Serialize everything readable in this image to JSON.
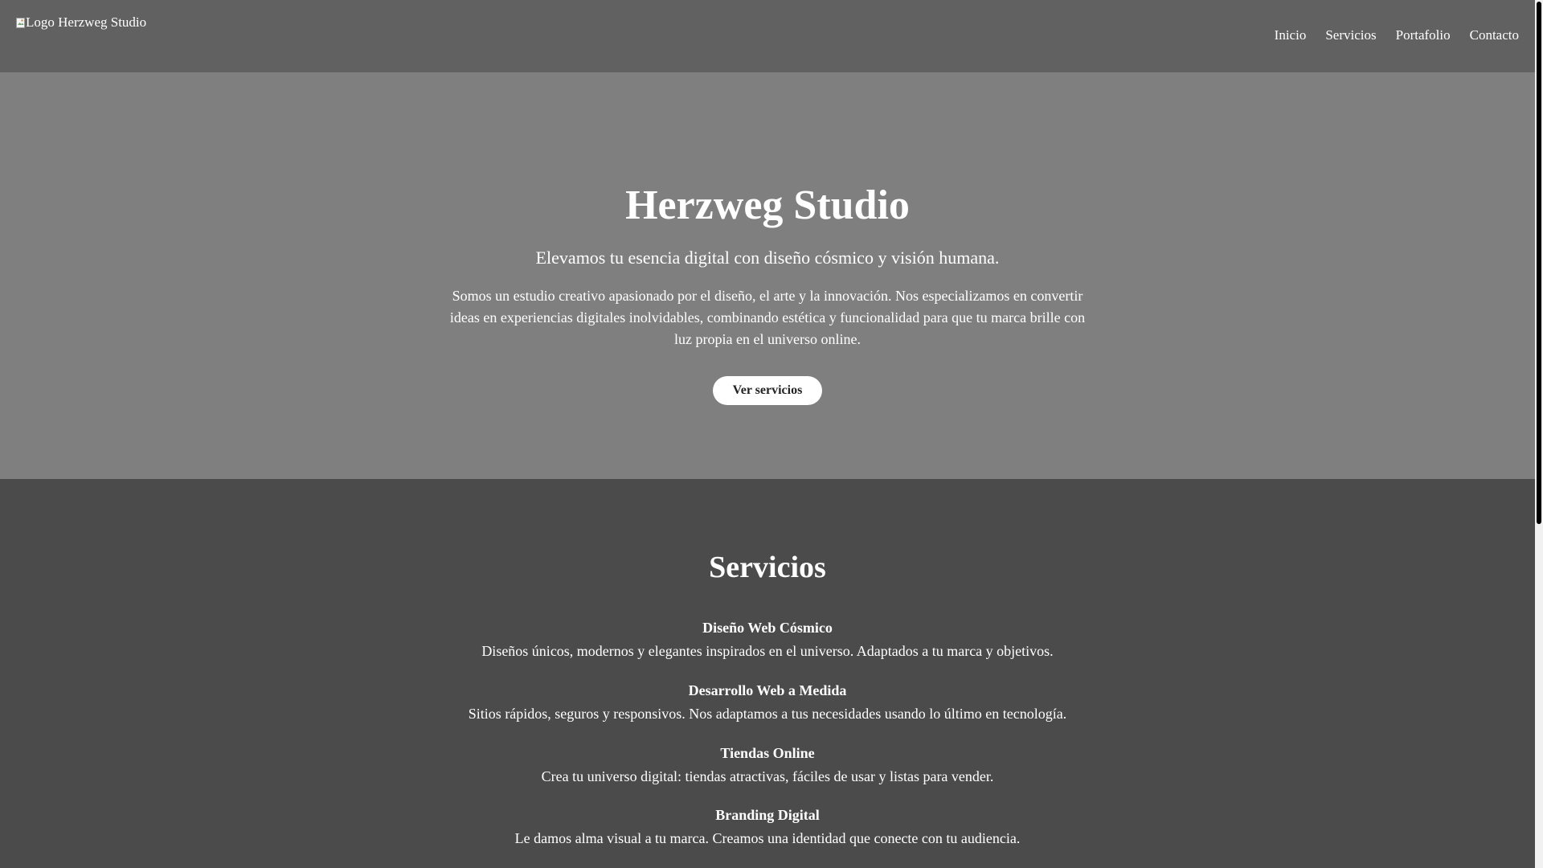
{
  "header": {
    "logo_alt": "Logo Herzweg Studio",
    "nav": [
      {
        "label": "Inicio"
      },
      {
        "label": "Servicios"
      },
      {
        "label": "Portafolio"
      },
      {
        "label": "Contacto"
      }
    ]
  },
  "hero": {
    "title": "Herzweg Studio",
    "subtitle": "Elevamos tu esencia digital con diseño cósmico y visión humana.",
    "description": "Somos un estudio creativo apasionado por el diseño, el arte y la innovación. Nos especializamos en convertir ideas en experiencias digitales inolvidables, combinando estética y funcionalidad para que tu marca brille con luz propia en el universo online.",
    "cta_label": "Ver servicios"
  },
  "services": {
    "title": "Servicios",
    "items": [
      {
        "name": "Diseño Web Cósmico",
        "desc": "Diseños únicos, modernos y elegantes inspirados en el universo. Adaptados a tu marca y objetivos."
      },
      {
        "name": "Desarrollo Web a Medida",
        "desc": "Sitios rápidos, seguros y responsivos. Nos adaptamos a tus necesidades usando lo último en tecnología."
      },
      {
        "name": "Tiendas Online",
        "desc": "Crea tu universo digital: tiendas atractivas, fáciles de usar y listas para vender."
      },
      {
        "name": "Branding Digital",
        "desc": "Le damos alma visual a tu marca. Creamos una identidad que conecte con tu audiencia."
      }
    ]
  },
  "colors": {
    "header_bg": "#616161",
    "hero_bg": "#7f7f7f",
    "services_bg": "#4b4b4b",
    "text": "#ffffff",
    "button_bg": "#ffffff"
  }
}
